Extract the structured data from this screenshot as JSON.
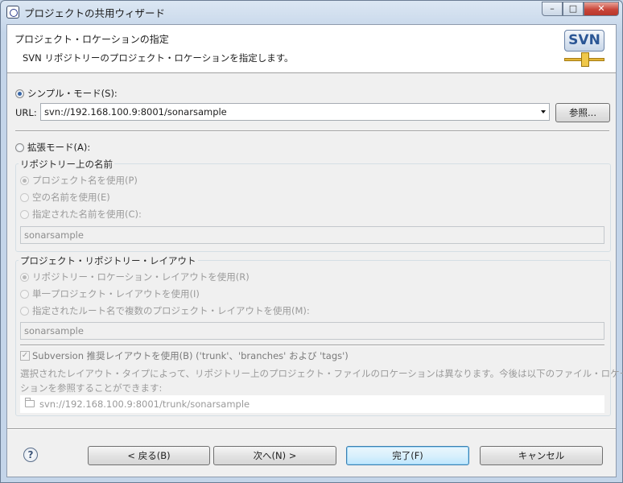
{
  "window": {
    "title": "プロジェクトの共用ウィザード",
    "controls": {
      "minimize": "–",
      "maximize": "□",
      "close": "✕"
    }
  },
  "banner": {
    "title": "プロジェクト・ロケーションの指定",
    "description": "SVN リポジトリーのプロジェクト・ロケーションを指定します。",
    "logo_text": "SVN"
  },
  "simple_mode": {
    "label": "シンプル・モード(S):",
    "selected": true,
    "url_label": "URL:",
    "url_value": "svn://192.168.100.9:8001/sonarsample",
    "browse_button": "参照..."
  },
  "advanced_mode": {
    "label": "拡張モード(A):",
    "selected": false,
    "name_group": {
      "title": "リポジトリー上の名前",
      "options": [
        {
          "label": "プロジェクト名を使用(P)",
          "selected": true
        },
        {
          "label": "空の名前を使用(E)",
          "selected": false
        },
        {
          "label": "指定された名前を使用(C):",
          "selected": false
        }
      ],
      "name_value": "sonarsample"
    },
    "layout_group": {
      "title": "プロジェクト・リポジトリー・レイアウト",
      "options": [
        {
          "label": "リポジトリー・ロケーション・レイアウトを使用(R)",
          "selected": true
        },
        {
          "label": "単一プロジェクト・レイアウトを使用(I)",
          "selected": false
        },
        {
          "label": "指定されたルート名で複数のプロジェクト・レイアウトを使用(M):",
          "selected": false
        }
      ],
      "root_value": "sonarsample",
      "recommended_checkbox": {
        "label": "Subversion 推奨レイアウトを使用(B) ('trunk'、'branches' および 'tags')",
        "checked": true
      },
      "info_line1": "選択されたレイアウト・タイプによって、リポジトリー上のプロジェクト・ファイルのロケーションは異なります。今後は以下のファイル・ロケー",
      "info_line2": "ションを参照することができます:",
      "preview_path": "svn://192.168.100.9:8001/trunk/sonarsample"
    }
  },
  "footer": {
    "help_icon": "?",
    "back": "< 戻る(B)",
    "next": "次へ(N) >",
    "finish": "完了(F)",
    "cancel": "キャンセル"
  }
}
